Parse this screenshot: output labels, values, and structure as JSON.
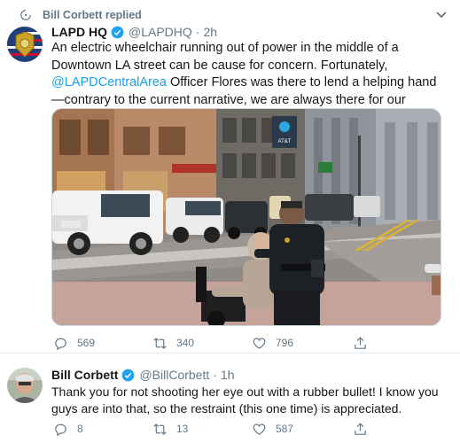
{
  "replied_by": "Bill Corbett replied",
  "tweets": [
    {
      "name": "LAPD HQ",
      "handle": "@LAPDHQ",
      "time": "2h",
      "text_before": "An electric wheelchair running out of power in the middle of a Downtown LA street can be cause for concern. Fortunately, ",
      "mention": "@LAPDCentralArea",
      "text_after": " Officer Flores was there to lend a helping hand—contrary to the current narrative, we are always there for our community.",
      "has_photo": true,
      "photo_sign_text": "AT&T",
      "replies": "569",
      "retweets": "340",
      "likes": "796"
    },
    {
      "name": "Bill Corbett",
      "handle": "@BillCorbett",
      "time": "1h",
      "text": "Thank you for not shooting her eye out with a rubber bullet! I know you guys are into that, so the restraint (this one time) is appreciated.",
      "replies": "8",
      "retweets": "13",
      "likes": "587"
    }
  ],
  "icons": {
    "reply": "reply-icon",
    "retweet": "retweet-icon",
    "like": "heart-icon",
    "share": "share-icon",
    "verified": "verified-badge-icon",
    "replied": "reply-arrow-icon",
    "caret": "chevron-down-icon"
  },
  "colors": {
    "accent": "#1da1f2",
    "muted": "#657786",
    "text": "#14171a",
    "divider": "#e6ecf0"
  }
}
